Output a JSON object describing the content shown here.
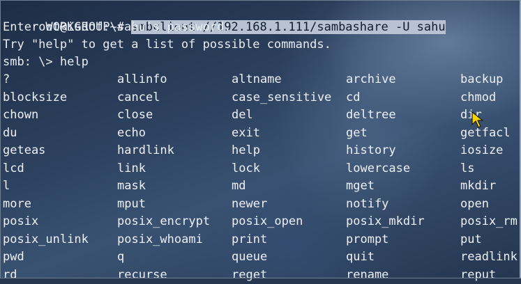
{
  "prompt": "root@isdof:~#",
  "command": "smbclient //192.168.1.111/sambashare -U sahu",
  "password_prompt": "Enter WORKGROUP\\sahu's password:",
  "help_hint": "Try \"help\" to get a list of possible commands.",
  "smb_prompt": "smb: \\> help",
  "commands": [
    [
      "?",
      "allinfo",
      "altname",
      "archive",
      "backup"
    ],
    [
      "blocksize",
      "cancel",
      "case_sensitive",
      "cd",
      "chmod"
    ],
    [
      "chown",
      "close",
      "del",
      "deltree",
      "dir"
    ],
    [
      "du",
      "echo",
      "exit",
      "get",
      "getfacl"
    ],
    [
      "geteas",
      "hardlink",
      "help",
      "history",
      "iosize"
    ],
    [
      "lcd",
      "link",
      "lock",
      "lowercase",
      "ls"
    ],
    [
      "l",
      "mask",
      "md",
      "mget",
      "mkdir"
    ],
    [
      "more",
      "mput",
      "newer",
      "notify",
      "open"
    ],
    [
      "posix",
      "posix_encrypt",
      "posix_open",
      "posix_mkdir",
      "posix_rm"
    ],
    [
      "posix_unlink",
      "posix_whoami",
      "print",
      "prompt",
      "put"
    ],
    [
      "pwd",
      "q",
      "queue",
      "quit",
      "readlink"
    ],
    [
      "rd",
      "recurse",
      "reget",
      "rename",
      "reput"
    ]
  ],
  "colors": {
    "text": "#e8edf3",
    "selection_bg": "#b7c3d3",
    "selection_fg": "#0f1d2e"
  },
  "icons": {
    "pointer": "mouse-pointer-icon"
  }
}
